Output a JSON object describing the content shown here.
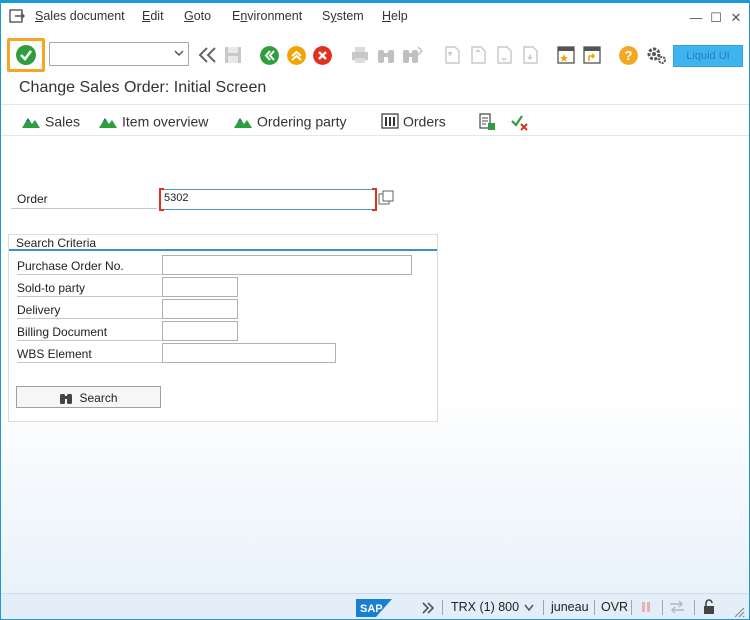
{
  "menubar": {
    "items": [
      {
        "label": "Sales document",
        "underline": "S",
        "rest": "ales document"
      },
      {
        "label": "Edit",
        "underline": "E",
        "rest": "dit"
      },
      {
        "label": "Goto",
        "underline": "G",
        "rest": "oto"
      },
      {
        "label": "Environment",
        "underline": "n",
        "pre": "E",
        "rest": "vironment"
      },
      {
        "label": "System",
        "underline": "y",
        "pre": "S",
        "rest": "stem"
      },
      {
        "label": "Help",
        "underline": "H",
        "rest": "elp"
      }
    ],
    "window_controls": {
      "minimize": "—",
      "maximize": "☐",
      "close": "✕"
    }
  },
  "toolbar": {
    "command_field": {
      "value": "",
      "placeholder": ""
    },
    "liquid_ui_label": "Liquid UI",
    "colors": {
      "enter_highlight": "#f5a623",
      "back": "#2e9e3f",
      "exit": "#f0a500",
      "cancel": "#e0301e",
      "help": "#f5a623"
    }
  },
  "screen": {
    "title": "Change Sales Order: Initial Screen"
  },
  "app_toolbar": {
    "sales_label": "Sales",
    "item_overview_label": "Item overview",
    "ordering_party_label": "Ordering party",
    "orders_label": "Orders"
  },
  "form": {
    "order_label": "Order",
    "order_value": "5302",
    "search_criteria": {
      "title": "Search Criteria",
      "purchase_order_label": "Purchase Order No.",
      "purchase_order_value": "",
      "sold_to_label": "Sold-to party",
      "sold_to_value": "",
      "delivery_label": "Delivery",
      "delivery_value": "",
      "billing_label": "Billing Document",
      "billing_value": "",
      "wbs_label": "WBS Element",
      "wbs_value": "",
      "search_button_label": "Search"
    }
  },
  "statusbar": {
    "logo_text": "SAP",
    "transaction": "TRX (1) 800",
    "user": "juneau",
    "mode": "OVR"
  }
}
